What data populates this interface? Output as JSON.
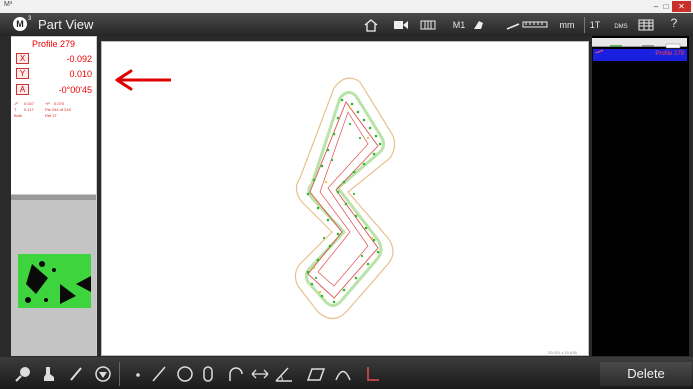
{
  "window": {
    "title": "M³",
    "minimize": "–",
    "maximize": "□",
    "close": "✕"
  },
  "header": {
    "logo": "M",
    "logo_sup": "3",
    "title": "Part View",
    "mode": "M1",
    "units": "mm",
    "tolerance": "1T",
    "angle_format": "DMS",
    "help": "?"
  },
  "dro": {
    "title": "Profile 279",
    "axes": [
      {
        "label": "X",
        "value": "-0.092"
      },
      {
        "label": "Y",
        "value": "0.010"
      },
      {
        "label": "A",
        "value": "-0°00'45"
      }
    ],
    "stats": {
      "minus_p": "-P",
      "minus_p_val": "0.047",
      "plus_p": "+P",
      "plus_p_val": "0.070",
      "t": "T",
      "t_val": "0.117",
      "pts": "Pts 244 of 249",
      "mode": "Both",
      "ref": "Ref 1T"
    }
  },
  "canvas": {
    "scale": "20.001 x 15.638"
  },
  "feature_list": {
    "items": [
      {
        "label": "Profile 279",
        "selected": true
      }
    ]
  },
  "toolbar": {
    "delete_label": "Delete"
  },
  "colors": {
    "accent_red": "#e00000",
    "selection_blue": "#1a20e0",
    "canvas_bg": "#ffffff",
    "profile_green": "#2db82d",
    "profile_red": "#e03030"
  }
}
